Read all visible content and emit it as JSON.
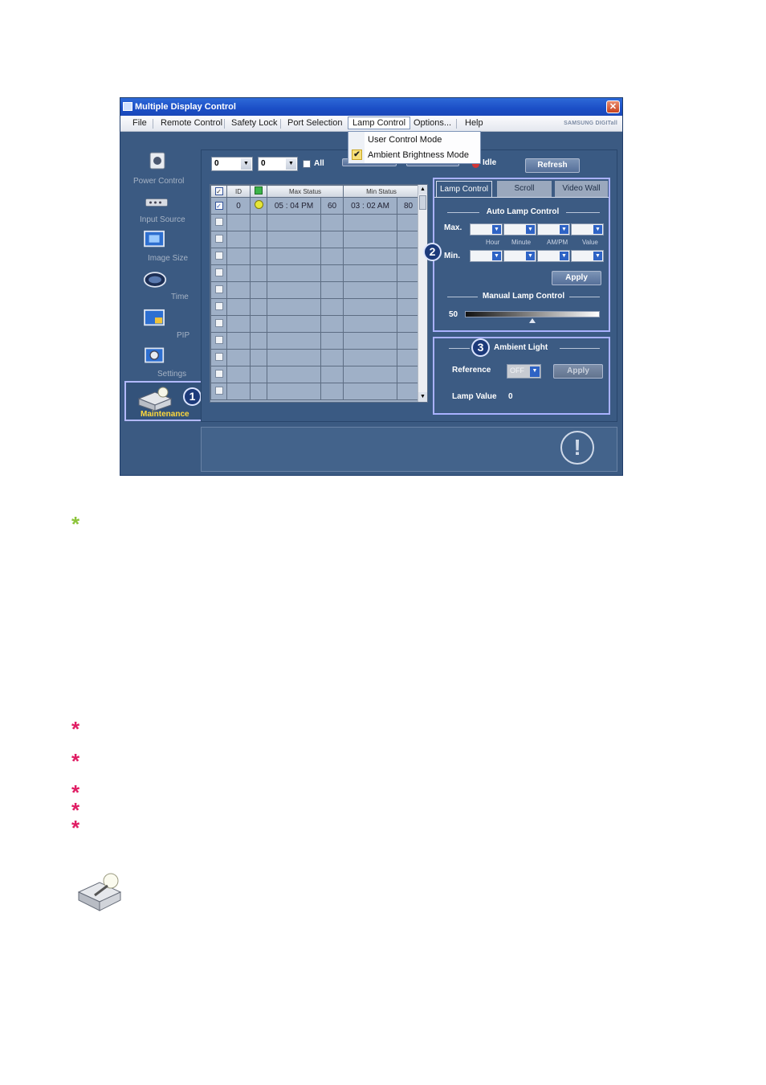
{
  "window": {
    "title": "Multiple Display Control",
    "close_label": "✕",
    "brand": "SAMSUNG DIGITall"
  },
  "menu": {
    "items": [
      "File",
      "Remote Control",
      "Safety Lock",
      "Port Selection",
      "Lamp Control",
      "Options...",
      "Help"
    ],
    "active": "Lamp Control",
    "dropdown": [
      "User Control Mode",
      "Ambient Brightness Mode"
    ],
    "checked_item": "Ambient Brightness Mode",
    "check_glyph": "✔"
  },
  "sidebar": {
    "items": [
      {
        "label": "Power Control",
        "icon": "power-control-icon"
      },
      {
        "label": "Input Source",
        "icon": "input-source-icon"
      },
      {
        "label": "Image Size",
        "icon": "image-size-icon"
      },
      {
        "label": "Time",
        "icon": "time-icon"
      },
      {
        "label": "PIP",
        "icon": "pip-icon"
      },
      {
        "label": "Settings",
        "icon": "settings-icon"
      },
      {
        "label": "Maintenance",
        "icon": "maintenance-icon"
      }
    ],
    "selected": "Maintenance",
    "callout": "1"
  },
  "toolbar": {
    "combo1": "0",
    "combo2": "0",
    "combo_arrow": "▼",
    "all_label": "All",
    "select_label": "Select",
    "clear_label": "Clear",
    "status_label": "Idle",
    "refresh_label": "Refresh"
  },
  "grid": {
    "headers": [
      "",
      "ID",
      "",
      "Max Status",
      "",
      "Min Status",
      ""
    ],
    "first_row": {
      "id": "0",
      "max_time": "05 : 04 PM",
      "max_value": "60",
      "min_time": "03 : 02 AM",
      "min_value": "80"
    },
    "empty_rows": 11,
    "scroll_up": "▲",
    "scroll_down": "▼"
  },
  "lamp_panel": {
    "tabs": [
      "Lamp Control",
      "Scroll",
      "Video Wall"
    ],
    "active_tab": "Lamp Control",
    "callout": "2",
    "auto_title": "Auto Lamp Control",
    "max_label": "Max.",
    "min_label": "Min.",
    "field_labels": [
      "Hour",
      "Minute",
      "AM/PM",
      "Value"
    ],
    "select_arrow": "▼",
    "apply_label": "Apply",
    "manual_title": "Manual Lamp Control",
    "manual_value": "50",
    "manual_fraction": 0.5
  },
  "ambient_panel": {
    "callout": "3",
    "title": "Ambient Light",
    "reference_label": "Reference",
    "reference_value": "OFF",
    "apply_label": "Apply",
    "lamp_value_label": "Lamp Value",
    "lamp_value": "0"
  },
  "status": {
    "warning_glyph": "!"
  },
  "notes": {
    "asterisk": "*"
  },
  "colors": {
    "note_green": "#8cc43a",
    "note_pink": "#e01c63",
    "highlight_border": "#a9b1ff",
    "selected_label": "#ffd93b"
  }
}
